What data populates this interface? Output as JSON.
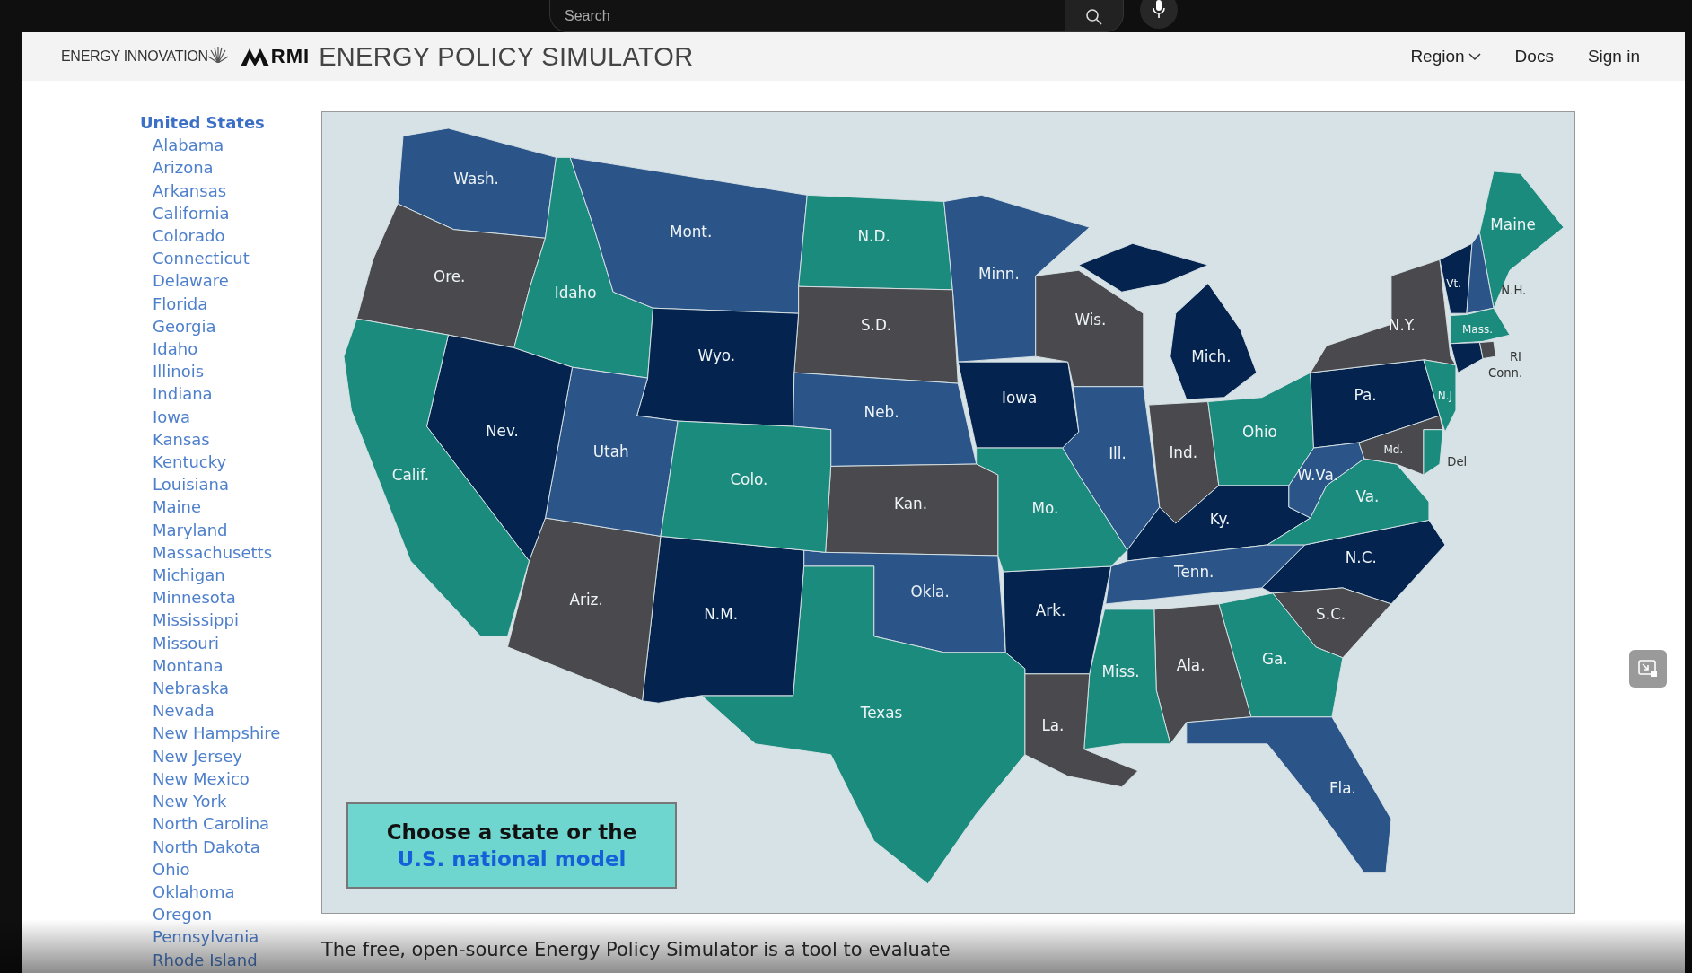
{
  "browser_bar": {
    "search_placeholder": "Search"
  },
  "header": {
    "logo_text": "ENERGY INNOVATION",
    "brand": "RMI",
    "title": "ENERGY POLICY SIMULATOR",
    "nav": [
      {
        "label": "Region",
        "kind": "dropdown"
      },
      {
        "label": "Docs",
        "kind": "link"
      },
      {
        "label": "Sign in",
        "kind": "link"
      }
    ]
  },
  "sidebar": {
    "heading": "United States",
    "items": [
      "Alabama",
      "Arizona",
      "Arkansas",
      "California",
      "Colorado",
      "Connecticut",
      "Delaware",
      "Florida",
      "Georgia",
      "Idaho",
      "Illinois",
      "Indiana",
      "Iowa",
      "Kansas",
      "Kentucky",
      "Louisiana",
      "Maine",
      "Maryland",
      "Massachusetts",
      "Michigan",
      "Minnesota",
      "Mississippi",
      "Missouri",
      "Montana",
      "Nebraska",
      "Nevada",
      "New Hampshire",
      "New Jersey",
      "New Mexico",
      "New York",
      "North Carolina",
      "North Dakota",
      "Ohio",
      "Oklahoma",
      "Oregon",
      "Pennsylvania",
      "Rhode Island"
    ]
  },
  "map": {
    "states": [
      {
        "label": "Wash.",
        "color": "#2b5489"
      },
      {
        "label": "Ore.",
        "color": "#4a4a4e"
      },
      {
        "label": "Idaho",
        "color": "#1b8b7d"
      },
      {
        "label": "Mont.",
        "color": "#2b5489"
      },
      {
        "label": "N.D.",
        "color": "#1b8b7d"
      },
      {
        "label": "Minn.",
        "color": "#2b5489"
      },
      {
        "label": "S.D.",
        "color": "#4a4a4e"
      },
      {
        "label": "Wyo.",
        "color": "#04234f"
      },
      {
        "label": "Neb.",
        "color": "#2b5489"
      },
      {
        "label": "Iowa",
        "color": "#04234f"
      },
      {
        "label": "Wis.",
        "color": "#4a4a4e"
      },
      {
        "label": "Mich.",
        "color": "#04234f"
      },
      {
        "label": "Ill.",
        "color": "#2b5489"
      },
      {
        "label": "Ind.",
        "color": "#4a4a4e"
      },
      {
        "label": "Ohio",
        "color": "#1b8b7d"
      },
      {
        "label": "Ky.",
        "color": "#04234f"
      },
      {
        "label": "Tenn.",
        "color": "#2b5489"
      },
      {
        "label": "N.C.",
        "color": "#04234f"
      },
      {
        "label": "S.C.",
        "color": "#4a4a4e"
      },
      {
        "label": "Ga.",
        "color": "#1b8b7d"
      },
      {
        "label": "Ala.",
        "color": "#4a4a4e"
      },
      {
        "label": "Miss.",
        "color": "#1b8b7d"
      },
      {
        "label": "Ark.",
        "color": "#04234f"
      },
      {
        "label": "La.",
        "color": "#4a4a4e"
      },
      {
        "label": "Fla.",
        "color": "#2b5489"
      },
      {
        "label": "Mo.",
        "color": "#1b8b7d"
      },
      {
        "label": "Kan.",
        "color": "#4a4a4e"
      },
      {
        "label": "Okla.",
        "color": "#2b5489"
      },
      {
        "label": "Texas",
        "color": "#1b8b7d"
      },
      {
        "label": "N.M.",
        "color": "#04234f"
      },
      {
        "label": "Ariz.",
        "color": "#4a4a4e"
      },
      {
        "label": "Utah",
        "color": "#2b5489"
      },
      {
        "label": "Colo.",
        "color": "#1b8b7d"
      },
      {
        "label": "Nev.",
        "color": "#04234f"
      },
      {
        "label": "Calif.",
        "color": "#1b8b7d"
      },
      {
        "label": "Pa.",
        "color": "#04234f"
      },
      {
        "label": "W.Va.",
        "color": "#2b5489"
      },
      {
        "label": "Va.",
        "color": "#1b8b7d"
      },
      {
        "label": "N.Y.",
        "color": "#4a4a4e"
      },
      {
        "label": "N.J",
        "color": "#1b8b7d"
      },
      {
        "label": "Md.",
        "color": "#4a4a4e"
      },
      {
        "label": "Del",
        "color": "#1b8b7d"
      },
      {
        "label": "Maine",
        "color": "#1b8b7d"
      },
      {
        "label": "Vt.",
        "color": "#04234f"
      },
      {
        "label": "N.H.",
        "color": "#2b5489"
      },
      {
        "label": "Mass.",
        "color": "#1b8b7d"
      },
      {
        "label": "RI",
        "color": "#4a4a4e"
      },
      {
        "label": "Conn.",
        "color": "#04234f"
      }
    ],
    "callout": {
      "text": "Choose a state or the",
      "link": "U.S. national model"
    }
  },
  "intro": "The free, open-source Energy Policy Simulator is a tool to evaluate"
}
